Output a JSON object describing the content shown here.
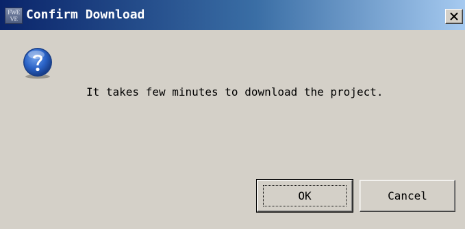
{
  "window": {
    "title": "Confirm Download",
    "app_icon_text": [
      "FWE",
      "VE"
    ]
  },
  "dialog": {
    "icon": "question-icon",
    "message": "It takes few minutes to download the project."
  },
  "buttons": {
    "ok_label": "OK",
    "cancel_label": "Cancel",
    "close_icon": "close-icon"
  },
  "colors": {
    "titlebar_start": "#0a246a",
    "titlebar_end": "#a6caf0",
    "dialog_background": "#d4d0c8",
    "question_icon_blue": "#2a63c7"
  }
}
